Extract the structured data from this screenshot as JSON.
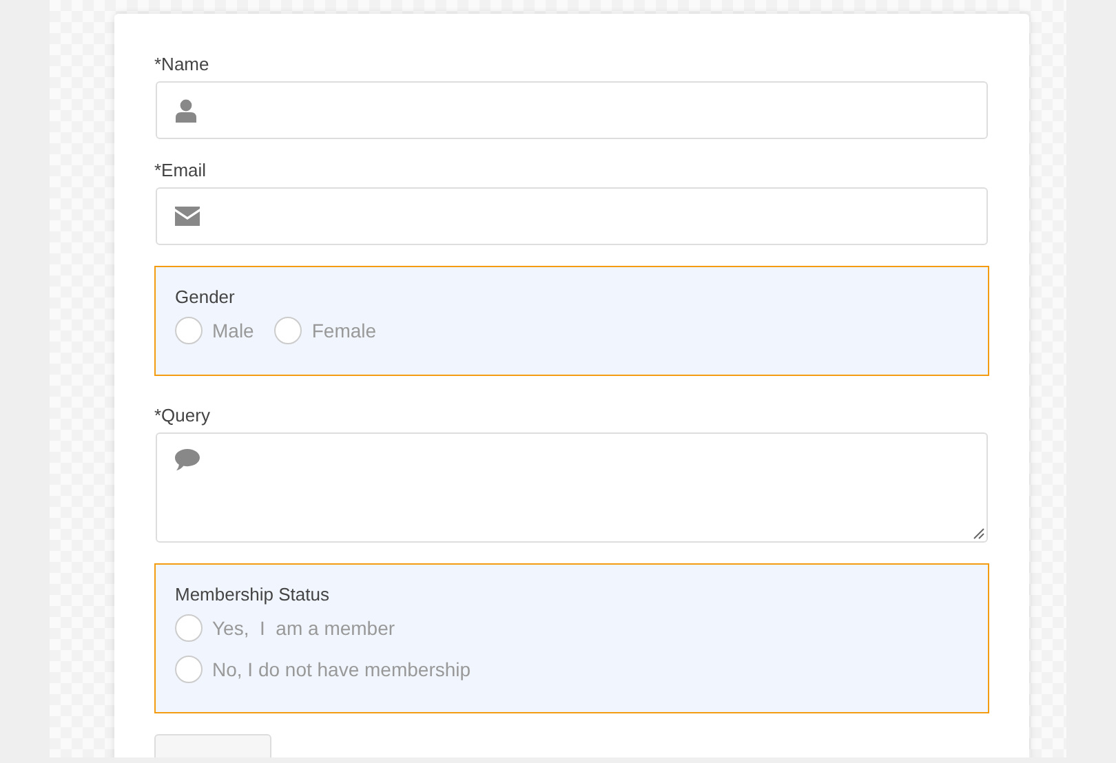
{
  "form": {
    "items": [
      {
        "kind": "name",
        "label": "*Name"
      },
      {
        "kind": "email",
        "label": "*Email"
      },
      {
        "kind": "choice-row",
        "label": "Gender",
        "options": [
          {
            "label": "Male",
            "selected": false
          },
          {
            "label": "Female",
            "selected": false
          }
        ]
      },
      {
        "kind": "message",
        "label": "*Query"
      },
      {
        "kind": "choice-list",
        "label": "Membership Status",
        "options": [
          {
            "label": "Yes,  I  am a member",
            "selected": false
          },
          {
            "label": "No, I do not have membership",
            "selected": false
          }
        ]
      }
    ]
  }
}
